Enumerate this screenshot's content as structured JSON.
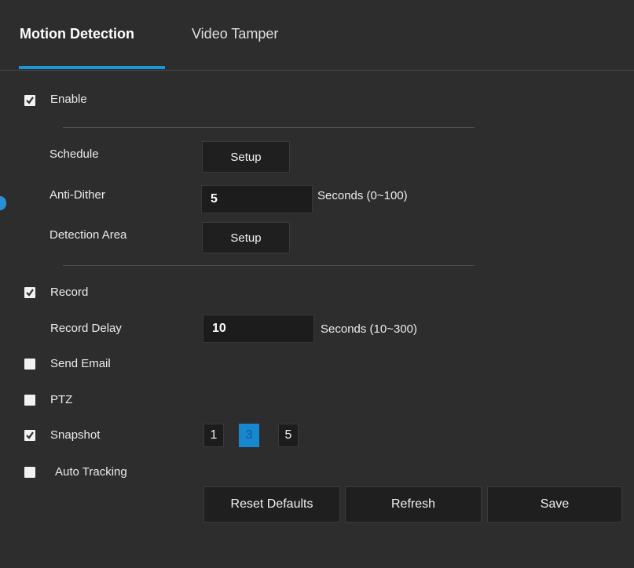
{
  "tabs": [
    {
      "label": "Motion Detection",
      "active": true
    },
    {
      "label": "Video Tamper",
      "active": false
    }
  ],
  "enable": {
    "label": "Enable",
    "checked": true
  },
  "schedule": {
    "label": "Schedule",
    "button": "Setup"
  },
  "anti_dither": {
    "label": "Anti-Dither",
    "value": "5",
    "hint": "Seconds (0~100)"
  },
  "detection_area": {
    "label": "Detection Area",
    "button": "Setup"
  },
  "record": {
    "label": "Record",
    "checked": true
  },
  "record_delay": {
    "label": "Record Delay",
    "value": "10",
    "hint": "Seconds (10~300)"
  },
  "send_email": {
    "label": "Send Email",
    "checked": false
  },
  "ptz": {
    "label": "PTZ",
    "checked": false
  },
  "snapshot": {
    "label": "Snapshot",
    "checked": true,
    "options": [
      "1",
      "3",
      "5"
    ],
    "selected": "3"
  },
  "auto_tracking": {
    "label": "Auto Tracking",
    "checked": false
  },
  "buttons": {
    "reset": "Reset Defaults",
    "refresh": "Refresh",
    "save": "Save"
  },
  "colors": {
    "accent": "#1a95d8",
    "background": "#2d2d2d",
    "field": "#1c1c1c"
  },
  "icons": {
    "checkbox_checked": "check-icon"
  }
}
